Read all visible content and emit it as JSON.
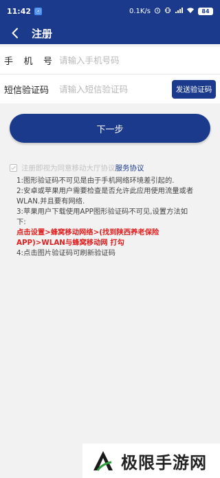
{
  "status_bar": {
    "time": "11:42",
    "app_icon_glyph": "ⓐ",
    "speed": "0.1K/s",
    "battery": "84"
  },
  "header": {
    "title": "注册"
  },
  "form": {
    "phone_label_chars": [
      "手",
      "机",
      "号"
    ],
    "phone_placeholder": "请输入手机号码",
    "sms_label": "短信验证码",
    "sms_placeholder": "请输入短信验证码",
    "send_button": "发送验证码"
  },
  "next_button": "下一步",
  "agreement": {
    "text": "注册即视为同意移动大厅协议",
    "link": "服务协议"
  },
  "tips": {
    "line1": "1:图形验证码不可见是由于手机网络环境差引起的.",
    "line2": "2:安卓或苹果用户需要检查是否允许此应用使用流量或者WLAN.并且要有网络.",
    "line3": "3:苹果用户下载使用APP图形验证码不可见,设置方法如下:",
    "line_red": "点击设置>蜂窝移动网络>(找到陕西养老保险APP)>WLAN与蜂窝移动网 打勾",
    "line4": "4:点击图片验证码可刷新验证码"
  },
  "watermark": {
    "text": "极限手游网"
  },
  "colors": {
    "primary": "#1b3a8c",
    "warning": "#e02020",
    "background": "#f2f2f2"
  }
}
